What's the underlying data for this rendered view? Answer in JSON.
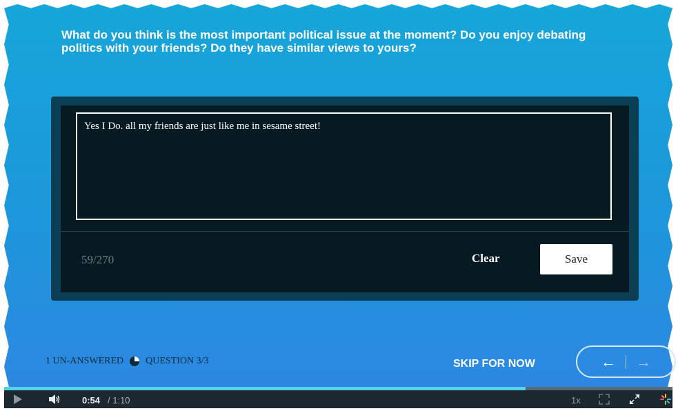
{
  "question": "What do you think is the most important political issue at the moment? Do you enjoy debating politics with your friends? Do they have similar views to yours?",
  "answer": {
    "value": "Yes I Do. all my friends are just like me in sesame street!",
    "char_count": "59/270"
  },
  "buttons": {
    "clear": "Clear",
    "save": "Save",
    "skip": "SKIP FOR NOW"
  },
  "footer": {
    "unanswered": "1 UN-ANSWERED",
    "question_progress": "QUESTION 3/3"
  },
  "nav": {
    "prev_symbol": "←",
    "next_symbol": "→"
  },
  "player": {
    "current_time": "0:54",
    "total_time": "/ 1:10",
    "speed": "1x",
    "progress_fraction": 0.78
  },
  "icons": {
    "progress_pie": "pie-chart-icon",
    "play": "play-icon",
    "volume": "volume-icon",
    "expand": "expand-icon",
    "fullscreen": "fullscreen-icon",
    "loading": "spinner-icon"
  },
  "colors": {
    "background_top": "#16a6d9",
    "background_bottom": "#2f86e3",
    "card": "#0a3e55",
    "card_inner": "#061a21",
    "progress": "#55d0ea"
  }
}
